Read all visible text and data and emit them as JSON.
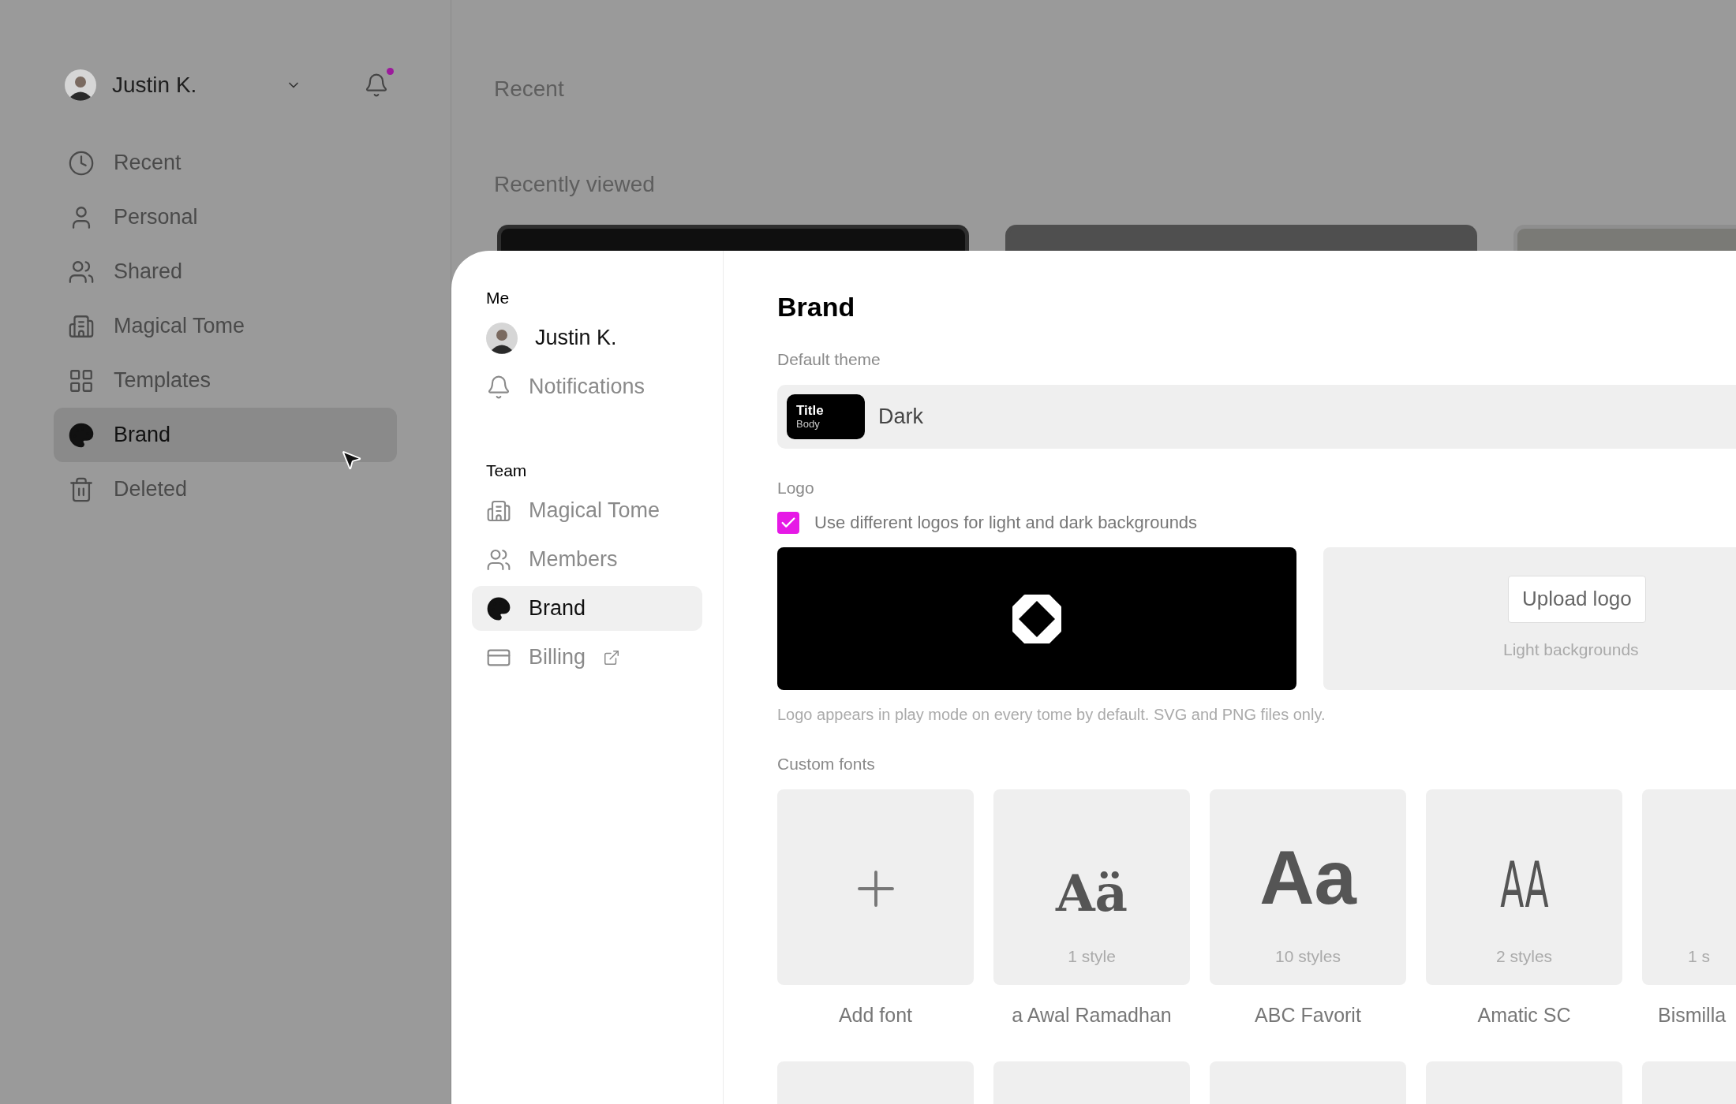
{
  "sidebar": {
    "user": {
      "name": "Justin K."
    },
    "notifications": {
      "unread": true
    },
    "items": [
      {
        "label": "Recent",
        "selected": false
      },
      {
        "label": "Personal",
        "selected": false
      },
      {
        "label": "Shared",
        "selected": false
      },
      {
        "label": "Magical Tome",
        "selected": false
      },
      {
        "label": "Templates",
        "selected": false
      },
      {
        "label": "Brand",
        "selected": true
      },
      {
        "label": "Deleted",
        "selected": false
      }
    ]
  },
  "main": {
    "title": "Recent",
    "section": "Recently viewed",
    "cards": [
      {
        "kind": "dark"
      },
      {
        "kind": "gray"
      },
      {
        "kind": "light"
      }
    ]
  },
  "settings": {
    "nav": [
      {
        "heading": "Me",
        "items": [
          {
            "label": "Justin K.",
            "selected": false
          },
          {
            "label": "Notifications",
            "selected": false
          }
        ]
      },
      {
        "heading": "Team",
        "items": [
          {
            "label": "Magical Tome",
            "selected": false
          },
          {
            "label": "Members",
            "selected": false
          },
          {
            "label": "Brand",
            "selected": true
          },
          {
            "label": "Billing",
            "selected": false,
            "external": true
          }
        ]
      }
    ],
    "title": "Brand",
    "theme": {
      "label": "Default theme",
      "chip_title": "Title",
      "chip_body": "Body",
      "value": "Dark"
    },
    "logo": {
      "label": "Logo",
      "checkbox": {
        "label": "Use different logos for light and dark backgrounds",
        "checked": true
      },
      "upload_button": "Upload logo",
      "light_caption": "Light backgrounds",
      "hint": "Logo appears in play mode on every tome by default. SVG and PNG files only."
    },
    "fonts": {
      "label": "Custom fonts",
      "items": [
        {
          "kind": "add",
          "name": "Add font"
        },
        {
          "kind": "font",
          "sample": "Aä",
          "count": "1 style",
          "name": "a Awal Ramadhan"
        },
        {
          "kind": "font",
          "sample": "Aa",
          "count": "10 styles",
          "name": "ABC Favorit"
        },
        {
          "kind": "font",
          "sample": "AA",
          "count": "2 styles",
          "name": "Amatic SC"
        },
        {
          "kind": "cut",
          "count": "1 s",
          "name": "Bismilla"
        }
      ],
      "next_row": [
        {
          "kind": "card"
        },
        {
          "kind": "card"
        },
        {
          "kind": "card"
        },
        {
          "kind": "card"
        },
        {
          "kind": "cut"
        }
      ]
    }
  }
}
